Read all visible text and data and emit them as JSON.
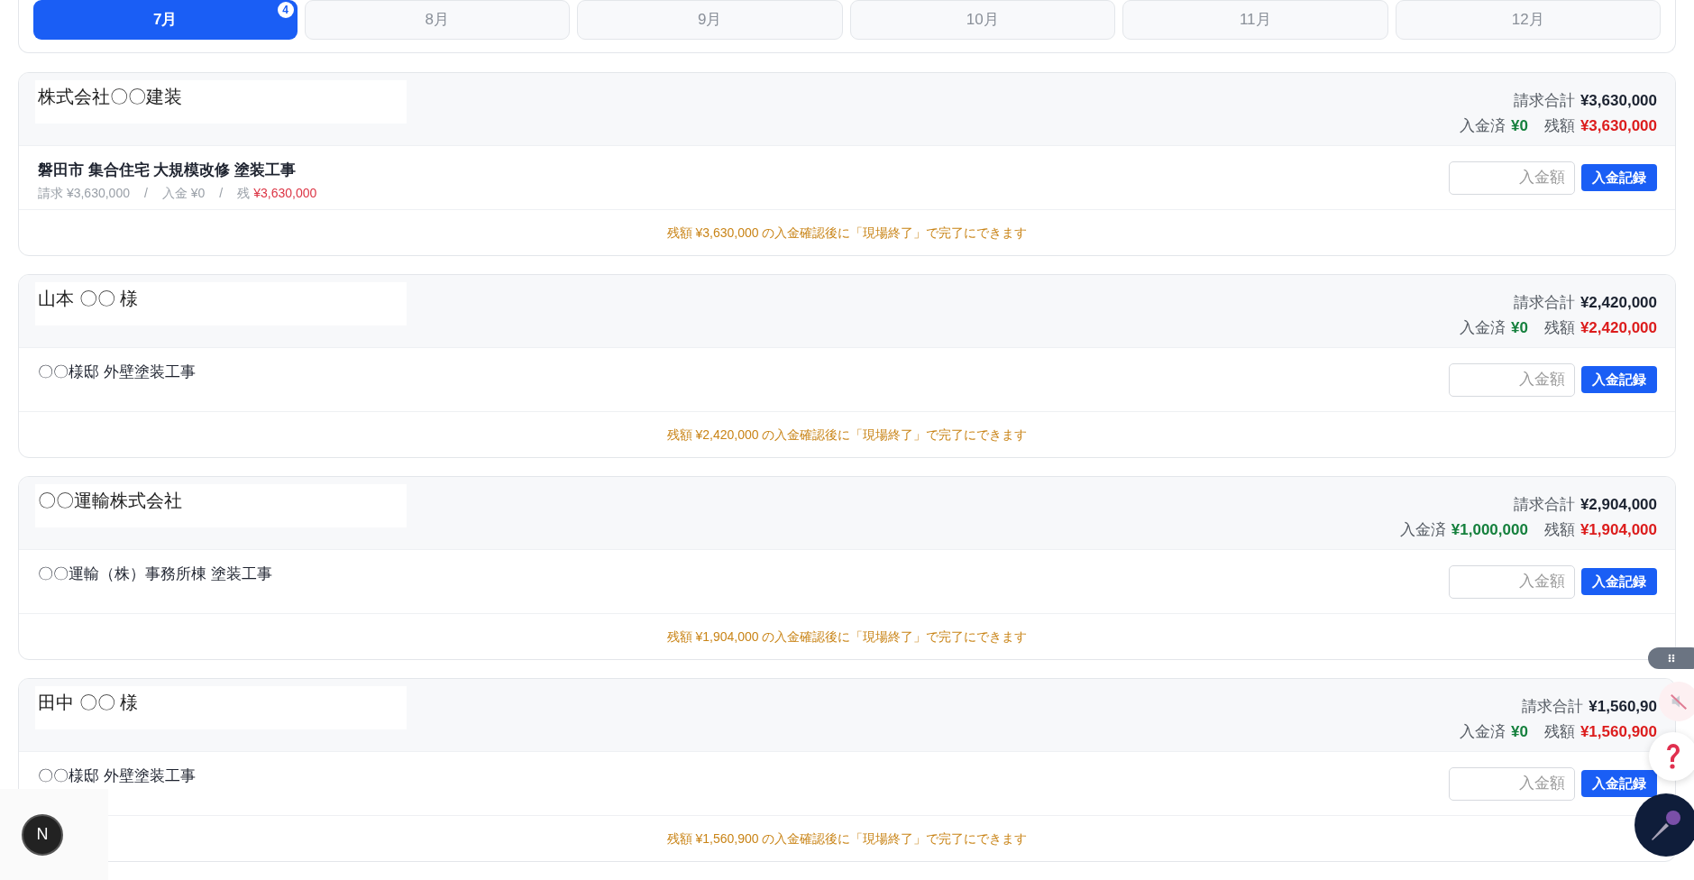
{
  "tabs": [
    {
      "label": "7月",
      "selected": true,
      "badge": "4"
    },
    {
      "label": "8月",
      "selected": false
    },
    {
      "label": "9月",
      "selected": false
    },
    {
      "label": "10月",
      "selected": false
    },
    {
      "label": "11月",
      "selected": false
    },
    {
      "label": "12月",
      "selected": false
    }
  ],
  "clients": [
    {
      "name": "株式会社〇〇建装",
      "billed_label": "請求合計",
      "billed": "¥3,630,000",
      "paid_label": "入金済",
      "paid": "¥0",
      "remaining_label": "残額",
      "remaining": "¥3,630,000",
      "job_title": "磐田市 集合住宅 大規模改修 塗装工事",
      "job_bold": true,
      "job_details": [
        {
          "text": "請求 ¥3,630,000",
          "kind": "plain"
        },
        {
          "text": "/",
          "kind": "separator"
        },
        {
          "text": "入金 ¥0",
          "kind": "plain"
        },
        {
          "text": "/",
          "kind": "separator"
        },
        {
          "text": "残",
          "kind": "plain"
        },
        {
          "text": "¥3,630,000",
          "kind": "alert"
        }
      ],
      "amount_placeholder": "入金額",
      "record_button": "入金記録",
      "note": "残額 ¥3,630,000 の入金確認後に「現場終了」で完了にできます"
    },
    {
      "name": "山本 〇〇 様",
      "billed_label": "請求合計",
      "billed": "¥2,420,000",
      "paid_label": "入金済",
      "paid": "¥0",
      "remaining_label": "残額",
      "remaining": "¥2,420,000",
      "job_title": "〇〇様邸 外壁塗装工事",
      "job_bold": false,
      "amount_placeholder": "入金額",
      "record_button": "入金記録",
      "note": "残額 ¥2,420,000 の入金確認後に「現場終了」で完了にできます"
    },
    {
      "name": "〇〇運輸株式会社",
      "billed_label": "請求合計",
      "billed": "¥2,904,000",
      "paid_label": "入金済",
      "paid": "¥1,000,000",
      "remaining_label": "残額",
      "remaining": "¥1,904,000",
      "job_title": "〇〇運輸（株）事務所棟 塗装工事",
      "job_bold": false,
      "amount_placeholder": "入金額",
      "record_button": "入金記録",
      "note": "残額 ¥1,904,000 の入金確認後に「現場終了」で完了にできます"
    },
    {
      "name": "田中 〇〇 様",
      "billed_label": "請求合計",
      "billed": "¥1,560,90",
      "paid_label": "入金済",
      "paid": "¥0",
      "remaining_label": "残額",
      "remaining": "¥1,560,900",
      "job_title": "〇〇様邸 外壁塗装工事",
      "job_bold": false,
      "amount_placeholder": "入金額",
      "record_button": "入金記録",
      "note": "残額 ¥1,560,900 の入金確認後に「現場終了」で完了にできます"
    }
  ],
  "dev_badge": "N"
}
